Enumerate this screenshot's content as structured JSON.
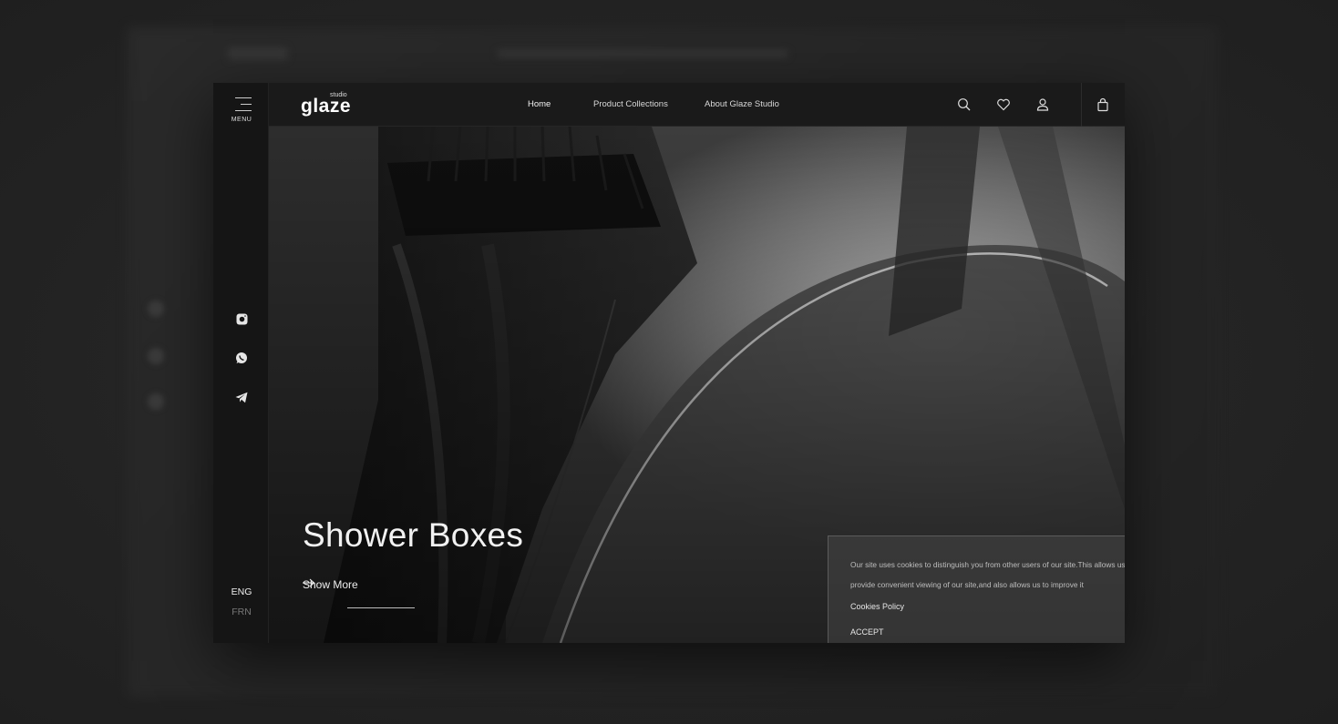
{
  "brand": {
    "name": "glaze",
    "sub": "studio"
  },
  "sidebar": {
    "menu_label": "MENU",
    "social": [
      {
        "icon": "instagram-icon"
      },
      {
        "icon": "whatsapp-icon"
      },
      {
        "icon": "telegram-icon"
      }
    ],
    "languages": [
      "ENG",
      "FRN"
    ],
    "active_language": "ENG"
  },
  "nav": {
    "items": [
      "Home",
      "Product Collections",
      "About Glaze Studio"
    ],
    "icons": [
      "search-icon",
      "heart-icon",
      "user-icon",
      "shopping-bag-icon"
    ]
  },
  "hero": {
    "title": "Shower Boxes",
    "cta": "Show More"
  },
  "cookie": {
    "text": "Our site uses cookies to distinguish you from other users of our site.This allows us to provide convenient viewing of our site,and also allows us to improve it",
    "policy_link": "Cookies Policy",
    "accept": "ACCEPT",
    "close": "×"
  },
  "colors": {
    "background": "#232323",
    "panel": "#151515",
    "topbar": "#1a1a1a",
    "text": "#e8e8e8"
  }
}
